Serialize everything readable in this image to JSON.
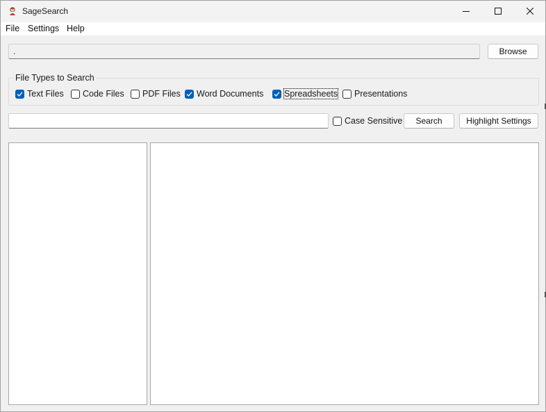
{
  "window": {
    "title": "SageSearch",
    "controls": {
      "minimize": "minimize-icon",
      "maximize": "maximize-icon",
      "close": "close-icon"
    }
  },
  "menubar": {
    "items": [
      {
        "label": "File"
      },
      {
        "label": "Settings"
      },
      {
        "label": "Help"
      }
    ]
  },
  "path": {
    "value": ".",
    "browse_label": "Browse"
  },
  "file_types": {
    "legend": "File Types to Search",
    "options": [
      {
        "label": "Text Files",
        "checked": true
      },
      {
        "label": "Code Files",
        "checked": false
      },
      {
        "label": "PDF Files",
        "checked": false
      },
      {
        "label": "Word Documents",
        "checked": true
      },
      {
        "label": "Spreadsheets",
        "checked": true
      },
      {
        "label": "Presentations",
        "checked": false
      }
    ]
  },
  "search": {
    "query": "",
    "case_sensitive_label": "Case Sensitive",
    "case_sensitive": false,
    "search_label": "Search",
    "highlight_label": "Highlight Settings"
  },
  "colors": {
    "accent": "#005fb8",
    "window_bg": "#f0f0f0"
  }
}
